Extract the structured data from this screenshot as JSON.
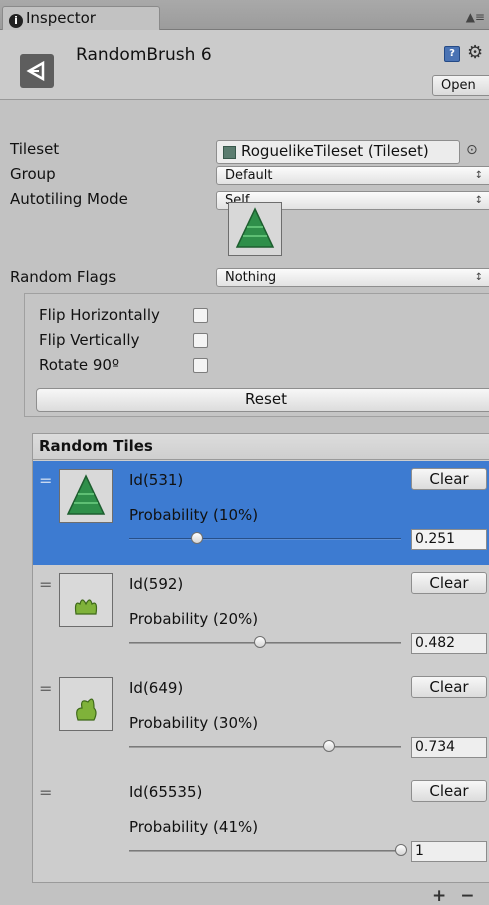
{
  "tab": {
    "title": "Inspector",
    "info_glyph": "i",
    "lock_glyph": "▲≡"
  },
  "header": {
    "object_name": "RandomBrush 6",
    "book_glyph": "?",
    "gear_glyph": "⚙",
    "open_label": "Open"
  },
  "fields": {
    "tileset_label": "Tileset",
    "tileset_value": "RoguelikeTileset (Tileset)",
    "group_label": "Group",
    "group_value": "Default",
    "autotiling_label": "Autotiling Mode",
    "autotiling_value": "Self",
    "random_flags_label": "Random Flags",
    "random_flags_value": "Nothing",
    "popup_arrows": "↕",
    "target_glyph": "⊙"
  },
  "flags": {
    "flip_horizontally": "Flip Horizontally",
    "flip_vertically": "Flip Vertically",
    "rotate_90": "Rotate 90º",
    "reset_label": "Reset"
  },
  "random_tiles": {
    "title": "Random Tiles",
    "handle_glyph": "=",
    "clear_label": "Clear",
    "items": [
      {
        "id": "Id(531)",
        "probability": "Probability (10%)",
        "value": "0.251",
        "slider": 0.251,
        "thumb": "tree"
      },
      {
        "id": "Id(592)",
        "probability": "Probability (20%)",
        "value": "0.482",
        "slider": 0.482,
        "thumb": "bush-small"
      },
      {
        "id": "Id(649)",
        "probability": "Probability (30%)",
        "value": "0.734",
        "slider": 0.734,
        "thumb": "bush-leaf"
      },
      {
        "id": "Id(65535)",
        "probability": "Probability (41%)",
        "value": "1",
        "slider": 1,
        "thumb": "none"
      }
    ],
    "add_glyph": "+",
    "remove_glyph": "−"
  },
  "colors": {
    "selection": "#3d7bd1",
    "tree_green": "#2f8f4a",
    "bush_green": "#7fb23a"
  }
}
